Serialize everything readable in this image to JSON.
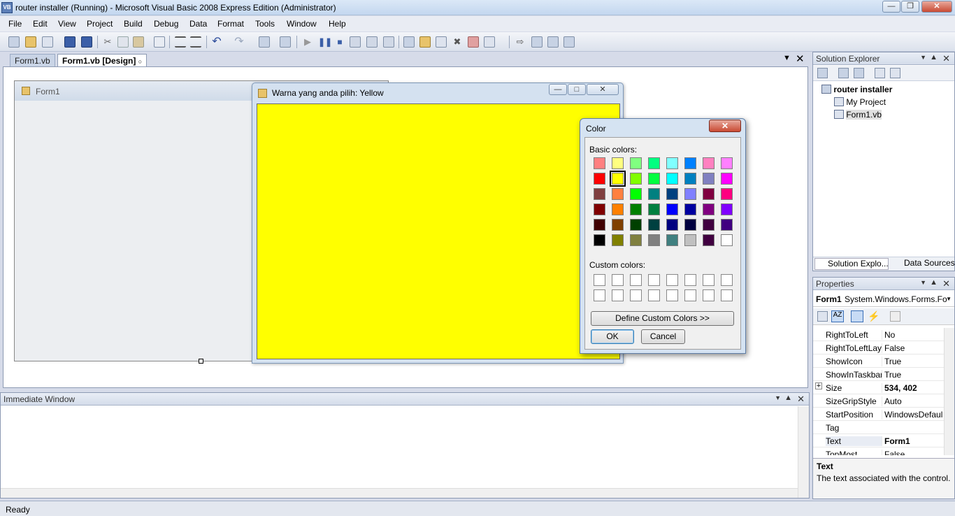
{
  "window": {
    "title": "router installer (Running) - Microsoft Visual Basic 2008 Express Edition (Administrator)"
  },
  "menu": [
    "File",
    "Edit",
    "View",
    "Project",
    "Build",
    "Debug",
    "Data",
    "Format",
    "Tools",
    "Window",
    "Help"
  ],
  "tabs": [
    {
      "label": "Form1.vb"
    },
    {
      "label": "Form1.vb [Design]"
    }
  ],
  "designer": {
    "form_title": "Form1"
  },
  "running_form": {
    "title": "Warna yang anda pilih: Yellow",
    "fill_color": "#ffff00"
  },
  "color_dialog": {
    "title": "Color",
    "basic_label": "Basic colors:",
    "custom_label": "Custom colors:",
    "define_button": "Define Custom Colors >>",
    "ok_button": "OK",
    "cancel_button": "Cancel",
    "selected_color": "#ffff00",
    "basic_colors": [
      [
        "#ff8080",
        "#ffff80",
        "#80ff80",
        "#00ff80",
        "#80ffff",
        "#0080ff",
        "#ff80c0",
        "#ff80ff"
      ],
      [
        "#ff0000",
        "#ffff00",
        "#80ff00",
        "#00ff40",
        "#00ffff",
        "#0080c0",
        "#8080c0",
        "#ff00ff"
      ],
      [
        "#804040",
        "#ff8040",
        "#00ff00",
        "#008080",
        "#004080",
        "#8080ff",
        "#800040",
        "#ff0080"
      ],
      [
        "#800000",
        "#ff8000",
        "#008000",
        "#008040",
        "#0000ff",
        "#0000a0",
        "#800080",
        "#8000ff"
      ],
      [
        "#400000",
        "#804000",
        "#004000",
        "#004040",
        "#000080",
        "#000040",
        "#400040",
        "#400080"
      ],
      [
        "#000000",
        "#808000",
        "#808040",
        "#808080",
        "#408080",
        "#c0c0c0",
        "#400040",
        "#ffffff"
      ]
    ]
  },
  "immediate": {
    "title": "Immediate Window"
  },
  "solution_explorer": {
    "title": "Solution Explorer",
    "items": [
      "router installer",
      "My Project",
      "Form1.vb"
    ],
    "bottom_tabs": [
      "Solution Explo...",
      "Data Sources"
    ]
  },
  "properties": {
    "title": "Properties",
    "object": "Form1",
    "object_type": "System.Windows.Forms.Fo",
    "rows": [
      {
        "name": "RightToLeft",
        "value": "No"
      },
      {
        "name": "RightToLeftLay",
        "value": "False"
      },
      {
        "name": "ShowIcon",
        "value": "True"
      },
      {
        "name": "ShowInTaskbar",
        "value": "True"
      },
      {
        "name": "Size",
        "value": "534, 402"
      },
      {
        "name": "SizeGripStyle",
        "value": "Auto"
      },
      {
        "name": "StartPosition",
        "value": "WindowsDefaul"
      },
      {
        "name": "Tag",
        "value": ""
      },
      {
        "name": "Text",
        "value": "Form1"
      },
      {
        "name": "TopMost",
        "value": "False"
      }
    ],
    "desc_title": "Text",
    "desc_text": "The text associated with the control."
  },
  "status": {
    "text": "Ready"
  }
}
